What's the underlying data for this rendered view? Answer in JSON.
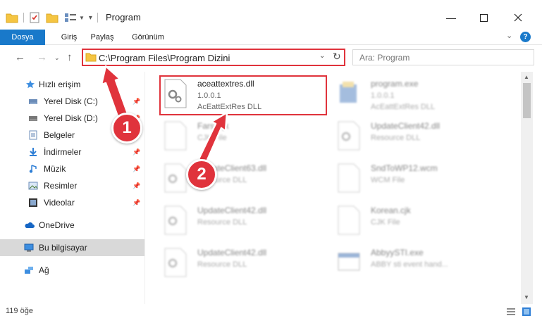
{
  "window": {
    "title": "Program"
  },
  "ribbon": {
    "tabs": [
      "Dosya",
      "Giriş",
      "Paylaş",
      "Görünüm"
    ],
    "help": "?"
  },
  "address": {
    "path": "C:\\Program Files\\Program Dizini",
    "search_placeholder": "Ara: Program"
  },
  "sidebar": {
    "items": [
      {
        "label": "Hızlı erişim",
        "icon": "star-icon"
      },
      {
        "label": "Yerel Disk (C:)",
        "icon": "drive-icon"
      },
      {
        "label": "Yerel Disk (D:)",
        "icon": "drive-icon"
      },
      {
        "label": "Belgeler",
        "icon": "documents-icon"
      },
      {
        "label": "İndirmeler",
        "icon": "download-icon"
      },
      {
        "label": "Müzik",
        "icon": "music-icon"
      },
      {
        "label": "Resimler",
        "icon": "pictures-icon"
      },
      {
        "label": "Videolar",
        "icon": "video-icon"
      },
      {
        "label": "OneDrive",
        "icon": "cloud-icon"
      },
      {
        "label": "Bu bilgisayar",
        "icon": "computer-icon"
      },
      {
        "label": "Ağ",
        "icon": "network-icon"
      }
    ]
  },
  "files": [
    {
      "name": "aceattextres.dll",
      "line1": "1.0.0.1",
      "line2": "AcEattExtRes DLL"
    },
    {
      "name": "program.exe",
      "line1": "1.0.0.1",
      "line2": "AcEattExtRes DLL"
    },
    {
      "name": "Farsi.cjk",
      "line1": "CJK File",
      "line2": ""
    },
    {
      "name": "UpdateClient42.dll",
      "line1": "Resource DLL",
      "line2": ""
    },
    {
      "name": "UpdateClient63.dll",
      "line1": "Resource DLL",
      "line2": ""
    },
    {
      "name": "SndToWP12.wcm",
      "line1": "WCM File",
      "line2": ""
    },
    {
      "name": "UpdateClient42.dll",
      "line1": "Resource DLL",
      "line2": ""
    },
    {
      "name": "Korean.cjk",
      "line1": "CJK File",
      "line2": ""
    },
    {
      "name": "UpdateClient42.dll",
      "line1": "Resource DLL",
      "line2": ""
    },
    {
      "name": "AbbyySTI.exe",
      "line1": "ABBY sti event hand...",
      "line2": ""
    }
  ],
  "status": {
    "count": "119 öğe"
  },
  "annotations": {
    "marker1": "1",
    "marker2": "2",
    "color": "#e0333c"
  },
  "colors": {
    "accent": "#1979ca",
    "highlight": "#e0333c"
  }
}
